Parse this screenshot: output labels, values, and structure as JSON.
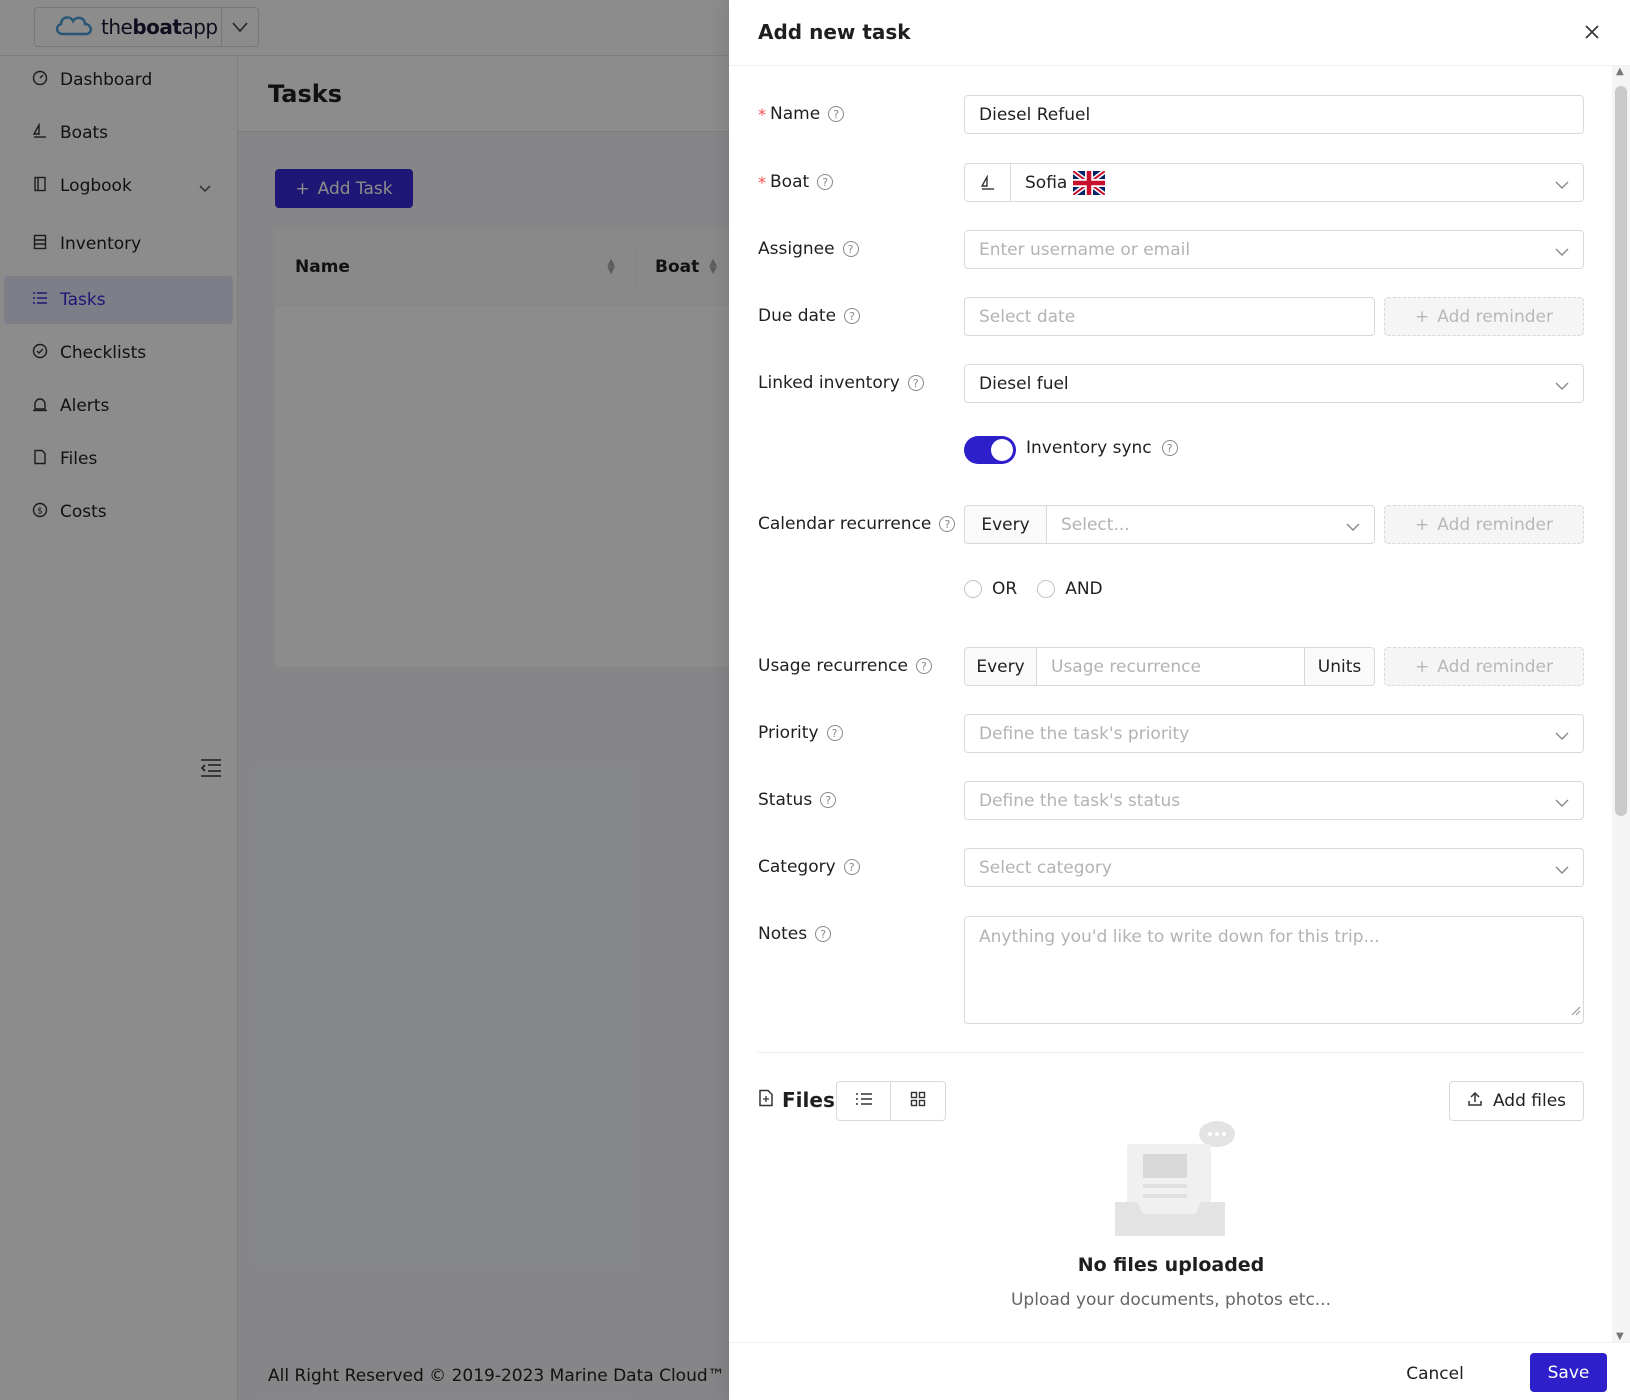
{
  "app": {
    "brand_prefix": "the",
    "brand_bold": "boat",
    "brand_suffix": "app"
  },
  "sidebar": {
    "items": [
      {
        "label": "Dashboard"
      },
      {
        "label": "Boats"
      },
      {
        "label": "Logbook"
      },
      {
        "label": "Inventory"
      },
      {
        "label": "Tasks"
      },
      {
        "label": "Checklists"
      },
      {
        "label": "Alerts"
      },
      {
        "label": "Files"
      },
      {
        "label": "Costs"
      }
    ]
  },
  "page": {
    "title": "Tasks",
    "add_task_label": "Add Task",
    "columns": [
      "Name",
      "Boat"
    ],
    "footer": "All Right Reserved © 2019-2023 Marine Data Cloud™"
  },
  "drawer": {
    "title": "Add new task",
    "fields": {
      "name": {
        "label": "Name",
        "value": "Diesel Refuel"
      },
      "boat": {
        "label": "Boat",
        "value": "Sofia"
      },
      "assignee": {
        "label": "Assignee",
        "placeholder": "Enter username or email"
      },
      "due_date": {
        "label": "Due date",
        "placeholder": "Select date"
      },
      "linked_inventory": {
        "label": "Linked inventory",
        "value": "Diesel fuel"
      },
      "inventory_sync": {
        "label": "Inventory sync",
        "enabled": true
      },
      "calendar_recurrence": {
        "label": "Calendar recurrence",
        "prefix": "Every",
        "placeholder": "Select..."
      },
      "logic": {
        "or_label": "OR",
        "and_label": "AND"
      },
      "usage_recurrence": {
        "label": "Usage recurrence",
        "prefix": "Every",
        "placeholder": "Usage recurrence",
        "suffix": "Units"
      },
      "priority": {
        "label": "Priority",
        "placeholder": "Define the task's priority"
      },
      "status": {
        "label": "Status",
        "placeholder": "Define the task's status"
      },
      "category": {
        "label": "Category",
        "placeholder": "Select category"
      },
      "notes": {
        "label": "Notes",
        "placeholder": "Anything you'd like to write down for this trip..."
      }
    },
    "add_reminder_label": "Add reminder",
    "files": {
      "title": "Files",
      "add_files_label": "Add files",
      "empty_title": "No files uploaded",
      "empty_subtitle": "Upload your documents, photos etc..."
    },
    "cancel_label": "Cancel",
    "save_label": "Save"
  },
  "colors": {
    "primary": "#2d1fc9",
    "required": "#ff4d4f"
  }
}
